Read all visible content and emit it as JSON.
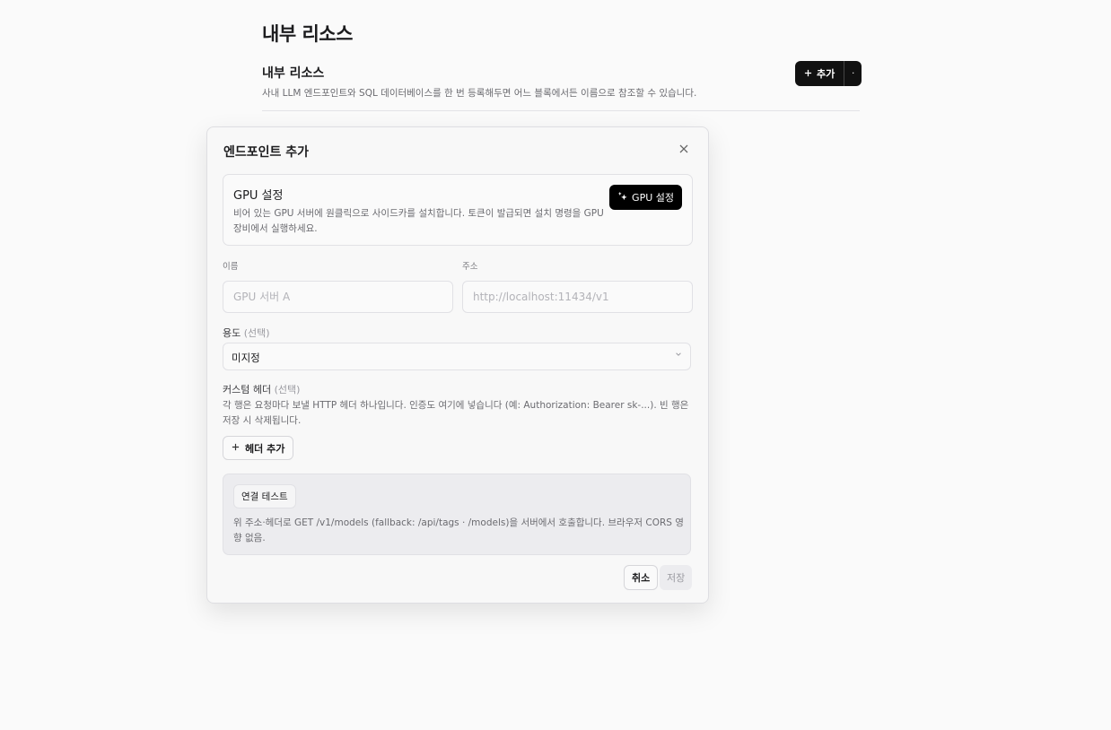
{
  "page": {
    "title": "내부 리소스",
    "section_title": "내부 리소스",
    "section_desc": "사내 LLM 엔드포인트와 SQL 데이터베이스를 한 번 등록해두면 어느 블록에서든 이름으로 참조할 수 있습니다.",
    "add_button": "추가",
    "add_more": "·"
  },
  "modal": {
    "title": "엔드포인트 추가",
    "close_icon": "close-icon",
    "gpu": {
      "title": "GPU 설정",
      "desc": "비어 있는 GPU 서버에 원클릭으로 사이드카를 설치합니다. 토큰이 발급되면 설치 명령을 GPU 장비에서 실행하세요.",
      "button": "GPU 설정",
      "icon": "sparkle-icon"
    },
    "name": {
      "label": "이름",
      "value": "",
      "placeholder": "GPU 서버 A"
    },
    "address": {
      "label": "주소",
      "value": "",
      "placeholder": "http://localhost:11434/v1"
    },
    "purpose": {
      "label": "용도",
      "label_note": "(선택)",
      "value": "미지정"
    },
    "headers": {
      "label": "커스텀 헤더",
      "label_note": "(선택)",
      "desc": "각 행은 요청마다 보낼 HTTP 헤더 하나입니다. 인증도 여기에 넣습니다 (예: Authorization: Bearer sk-...). 빈 행은 저장 시 삭제됩니다.",
      "add_button": "헤더 추가"
    },
    "test": {
      "button": "연결 테스트",
      "desc": "위 주소·헤더로 GET /v1/models (fallback: /api/tags · /models)을 서버에서 호출합니다. 브라우저 CORS 영향 없음."
    },
    "cancel": "취소",
    "save": "저장"
  },
  "colors": {
    "primary_button": "#111111",
    "background": "#fafafa",
    "muted_text": "#6b6b70"
  }
}
